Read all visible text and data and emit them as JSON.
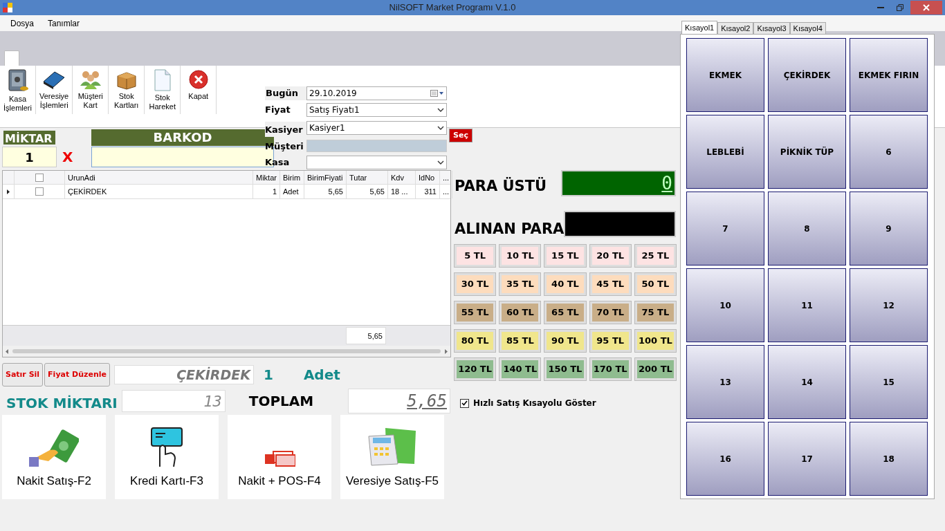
{
  "window": {
    "title": "NilSOFT Market Programı V.1.0"
  },
  "menu": [
    "Dosya",
    "Tanımlar"
  ],
  "toolbar": [
    {
      "label": "Kasa\nİşlemleri",
      "kind": "safe"
    },
    {
      "label": "Veresiye\nİşlemleri",
      "kind": "book"
    },
    {
      "label": "Müşteri\nKart",
      "kind": "people"
    },
    {
      "label": "Stok\nKartları",
      "kind": "box"
    },
    {
      "label": "Stok\nHareket",
      "kind": "document"
    },
    {
      "label": "Kapat",
      "kind": "close"
    }
  ],
  "form": {
    "date": {
      "label": "Bugün",
      "value": "29.10.2019"
    },
    "price": {
      "label": "Fiyat",
      "value": "Satış Fiyatı1"
    },
    "cashier": {
      "label": "Kasiyer",
      "value": "Kasiyer1"
    },
    "customer": {
      "label": "Müşteri",
      "button": "Seç"
    },
    "register": {
      "label": "Kasa"
    }
  },
  "entry": {
    "quantity_label": "MİKTAR",
    "quantity": "1",
    "times": "X",
    "barcode_label": "BARKOD"
  },
  "grid": {
    "columns": [
      "UrunAdi",
      "Miktar",
      "Birim",
      "BirimFiyati",
      "Tutar",
      "Kdv",
      "IdNo",
      "..."
    ],
    "header_checked": false,
    "rows": [
      {
        "selected": true,
        "checked": false,
        "cells": [
          "ÇEKİRDEK",
          "1",
          "Adet",
          "5,65",
          "5,65",
          "18 ...",
          "311",
          "..."
        ]
      }
    ],
    "total": "5,65"
  },
  "actions": [
    "Satır Sil",
    "Fiyat Düzenle"
  ],
  "product": {
    "name": "ÇEKİRDEK",
    "quantity": "1",
    "unit": "Adet"
  },
  "stock": {
    "label": "STOK MİKTARI",
    "value": "13"
  },
  "total": {
    "label": "TOPLAM",
    "value": "5,65"
  },
  "payments": [
    {
      "label": "Nakit Satış-F2",
      "kind": "cash"
    },
    {
      "label": "Kredi Kartı-F3",
      "kind": "card"
    },
    {
      "label": "Nakit + POS-F4",
      "kind": "money"
    },
    {
      "label": "Veresiye Satış-F5",
      "kind": "calculator"
    }
  ],
  "change": {
    "label": "PARA ÜSTÜ",
    "value": "0"
  },
  "received": {
    "label": "ALINAN PARA"
  },
  "money_buttons": [
    {
      "label": "5 TL",
      "color": "#fde3e3"
    },
    {
      "label": "10 TL",
      "color": "#fde3e3"
    },
    {
      "label": "15 TL",
      "color": "#fde3e3"
    },
    {
      "label": "20 TL",
      "color": "#fde3e3"
    },
    {
      "label": "25 TL",
      "color": "#fde3e3"
    },
    {
      "label": "30 TL",
      "color": "#fddcbd"
    },
    {
      "label": "35 TL",
      "color": "#fddcbd"
    },
    {
      "label": "40 TL",
      "color": "#fddcbd"
    },
    {
      "label": "45 TL",
      "color": "#fddcbd"
    },
    {
      "label": "50 TL",
      "color": "#fddcbd"
    },
    {
      "label": "55 TL",
      "color": "#c9ae88"
    },
    {
      "label": "60 TL",
      "color": "#c9ae88"
    },
    {
      "label": "65 TL",
      "color": "#c9ae88"
    },
    {
      "label": "70 TL",
      "color": "#c9ae88"
    },
    {
      "label": "75 TL",
      "color": "#c9ae88"
    },
    {
      "label": "80 TL",
      "color": "#f0e68c"
    },
    {
      "label": "85 TL",
      "color": "#f0e68c"
    },
    {
      "label": "90 TL",
      "color": "#f0e68c"
    },
    {
      "label": "95 TL",
      "color": "#f0e68c"
    },
    {
      "label": "100 TL",
      "color": "#f0e68c"
    },
    {
      "label": "120 TL",
      "color": "#8fbc8f"
    },
    {
      "label": "140 TL",
      "color": "#8fbc8f"
    },
    {
      "label": "150 TL",
      "color": "#8fbc8f"
    },
    {
      "label": "170 TL",
      "color": "#8fbc8f"
    },
    {
      "label": "200 TL",
      "color": "#8fbc8f"
    }
  ],
  "quick_sale": {
    "label": "Hızlı Satış Kısayolu Göster",
    "checked": true
  },
  "shortcuts": {
    "tabs": [
      {
        "label": "Kısayol1",
        "selected": true
      },
      {
        "label": "Kısayol2",
        "selected": false
      },
      {
        "label": "Kısayol3",
        "selected": false
      },
      {
        "label": "Kısayol4",
        "selected": false
      }
    ],
    "buttons": [
      "EKMEK",
      "ÇEKİRDEK",
      "EKMEK FIRIN",
      "LEBLEBİ",
      "PİKNİK TÜP",
      "6",
      "7",
      "8",
      "9",
      "10",
      "11",
      "12",
      "13",
      "14",
      "15",
      "16",
      "17",
      "18"
    ]
  }
}
